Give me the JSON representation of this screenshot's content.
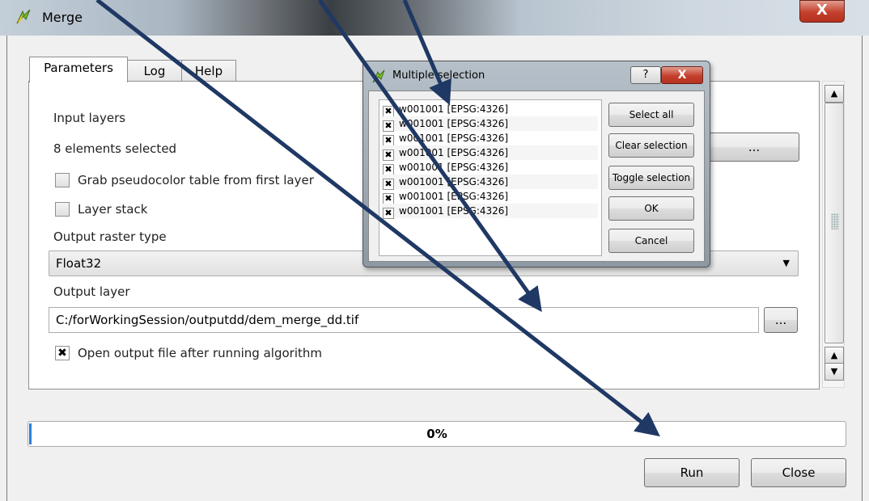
{
  "window": {
    "title": "Merge",
    "close_glyph": "X"
  },
  "tabs": [
    {
      "label": "Parameters",
      "active": true
    },
    {
      "label": "Log",
      "active": false
    },
    {
      "label": "Help",
      "active": false
    }
  ],
  "params": {
    "input_layers_label": "Input layers",
    "input_layers_value": "8 elements selected",
    "input_layers_button": "...",
    "grab_pseudocolor_label": "Grab pseudocolor table from first layer",
    "grab_pseudocolor_checked": false,
    "layer_stack_label": "Layer stack",
    "layer_stack_checked": false,
    "output_raster_type_label": "Output raster type",
    "output_raster_type_value": "Float32",
    "output_layer_label": "Output layer",
    "output_layer_value": "C:/forWorkingSession/outputdd/dem_merge_dd.tif",
    "output_layer_button": "...",
    "open_output_label": "Open output file after running algorithm",
    "open_output_checked": true
  },
  "progress": {
    "text": "0%",
    "fraction": 0.0
  },
  "buttons": {
    "run": "Run",
    "close": "Close"
  },
  "multiple_selection": {
    "title": "Multiple selection",
    "help_glyph": "?",
    "close_glyph": "X",
    "items": [
      {
        "label": "w001001 [EPSG:4326]",
        "checked": true
      },
      {
        "label": "w001001 [EPSG:4326]",
        "checked": true
      },
      {
        "label": "w001001 [EPSG:4326]",
        "checked": true
      },
      {
        "label": "w001001 [EPSG:4326]",
        "checked": true
      },
      {
        "label": "w001001 [EPSG:4326]",
        "checked": true
      },
      {
        "label": "w001001 [EPSG:4326]",
        "checked": true
      },
      {
        "label": "w001001 [EPSG:4326]",
        "checked": true
      },
      {
        "label": "w001001 [EPSG:4326]",
        "checked": true
      }
    ],
    "select_all": "Select all",
    "clear_selection": "Clear selection",
    "toggle_selection": "Toggle selection",
    "ok": "OK",
    "cancel": "Cancel"
  },
  "colors": {
    "annotation_arrow": "#1f3864",
    "progress_fill": "#2c7fd8",
    "close_button": "#c4402d"
  },
  "icons": [
    "qgis-app-icon",
    "close-icon",
    "help-icon",
    "chevron-down-icon",
    "scroll-up-icon",
    "scroll-down-icon",
    "checkmark-icon"
  ]
}
